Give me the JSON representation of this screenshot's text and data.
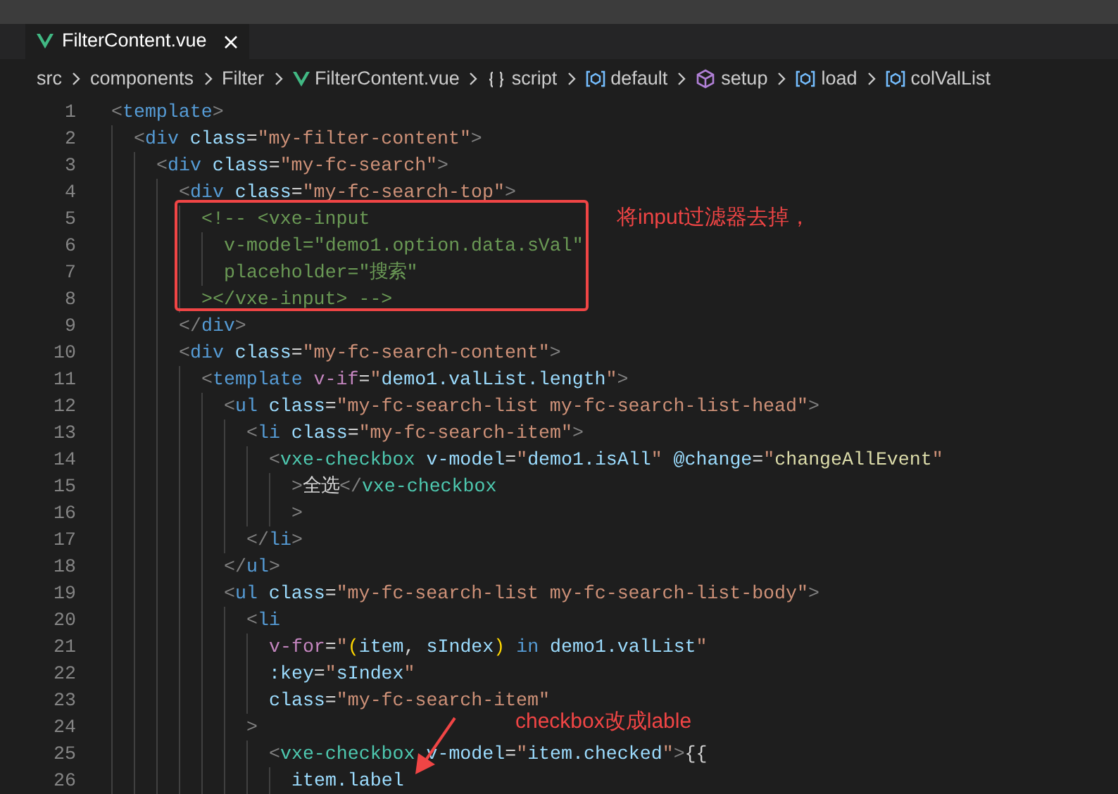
{
  "tabs": [
    {
      "label": "FilterContent.vue",
      "kind": "vue",
      "selected": true
    }
  ],
  "breadcrumb": [
    {
      "label": "src",
      "kind": "folder"
    },
    {
      "label": "components",
      "kind": "folder"
    },
    {
      "label": "Filter",
      "kind": "folder"
    },
    {
      "label": "FilterContent.vue",
      "kind": "vue"
    },
    {
      "label": "script",
      "kind": "block"
    },
    {
      "label": "default",
      "kind": "field"
    },
    {
      "label": "setup",
      "kind": "method"
    },
    {
      "label": "load",
      "kind": "field"
    },
    {
      "label": "colValList",
      "kind": "field"
    }
  ],
  "code": [
    {
      "number": "1",
      "tokens": [
        {
          "kind": "punct",
          "text": "<"
        },
        {
          "kind": "tag",
          "text": "template"
        },
        {
          "kind": "punct",
          "text": ">"
        }
      ]
    },
    {
      "number": "2",
      "tokens": [
        {
          "kind": "punct",
          "text": "  <"
        },
        {
          "kind": "tag",
          "text": "div"
        },
        {
          "kind": "attr",
          "text": " class"
        },
        {
          "kind": "plain",
          "text": "="
        },
        {
          "kind": "string",
          "text": "\"my-filter-content\""
        },
        {
          "kind": "punct",
          "text": ">"
        }
      ]
    },
    {
      "number": "3",
      "tokens": [
        {
          "kind": "punct",
          "text": "    <"
        },
        {
          "kind": "tag",
          "text": "div"
        },
        {
          "kind": "attr",
          "text": " class"
        },
        {
          "kind": "plain",
          "text": "="
        },
        {
          "kind": "string",
          "text": "\"my-fc-search\""
        },
        {
          "kind": "punct",
          "text": ">"
        }
      ]
    },
    {
      "number": "4",
      "tokens": [
        {
          "kind": "punct",
          "text": "      <"
        },
        {
          "kind": "tag",
          "text": "div"
        },
        {
          "kind": "attr",
          "text": " class"
        },
        {
          "kind": "plain",
          "text": "="
        },
        {
          "kind": "string",
          "text": "\"my-fc-search-top\""
        },
        {
          "kind": "punct",
          "text": ">"
        }
      ]
    },
    {
      "number": "5",
      "tokens": [
        {
          "kind": "comment",
          "text": "        <!-- <vxe-input"
        }
      ]
    },
    {
      "number": "6",
      "tokens": [
        {
          "kind": "comment",
          "text": "          v-model=\"demo1.option.data.sVal\""
        }
      ]
    },
    {
      "number": "7",
      "tokens": [
        {
          "kind": "comment",
          "text": "          placeholder=\"搜索\""
        }
      ]
    },
    {
      "number": "8",
      "tokens": [
        {
          "kind": "comment",
          "text": "        ></vxe-input> -->"
        }
      ]
    },
    {
      "number": "9",
      "tokens": [
        {
          "kind": "punct",
          "text": "      </"
        },
        {
          "kind": "tag",
          "text": "div"
        },
        {
          "kind": "punct",
          "text": ">"
        }
      ]
    },
    {
      "number": "10",
      "tokens": [
        {
          "kind": "punct",
          "text": "      <"
        },
        {
          "kind": "tag",
          "text": "div"
        },
        {
          "kind": "attr",
          "text": " class"
        },
        {
          "kind": "plain",
          "text": "="
        },
        {
          "kind": "string",
          "text": "\"my-fc-search-content\""
        },
        {
          "kind": "punct",
          "text": ">"
        }
      ]
    },
    {
      "number": "11",
      "tokens": [
        {
          "kind": "punct",
          "text": "        <"
        },
        {
          "kind": "tag",
          "text": "template"
        },
        {
          "kind": "directive",
          "text": " v-if"
        },
        {
          "kind": "plain",
          "text": "="
        },
        {
          "kind": "string",
          "text": "\""
        },
        {
          "kind": "variable",
          "text": "demo1.valList.length"
        },
        {
          "kind": "string",
          "text": "\""
        },
        {
          "kind": "punct",
          "text": ">"
        }
      ]
    },
    {
      "number": "12",
      "tokens": [
        {
          "kind": "punct",
          "text": "          <"
        },
        {
          "kind": "tag",
          "text": "ul"
        },
        {
          "kind": "attr",
          "text": " class"
        },
        {
          "kind": "plain",
          "text": "="
        },
        {
          "kind": "string",
          "text": "\"my-fc-search-list my-fc-search-list-head\""
        },
        {
          "kind": "punct",
          "text": ">"
        }
      ]
    },
    {
      "number": "13",
      "tokens": [
        {
          "kind": "punct",
          "text": "            <"
        },
        {
          "kind": "tag",
          "text": "li"
        },
        {
          "kind": "attr",
          "text": " class"
        },
        {
          "kind": "plain",
          "text": "="
        },
        {
          "kind": "string",
          "text": "\"my-fc-search-item\""
        },
        {
          "kind": "punct",
          "text": ">"
        }
      ]
    },
    {
      "number": "14",
      "tokens": [
        {
          "kind": "punct",
          "text": "              <"
        },
        {
          "kind": "component",
          "text": "vxe-checkbox"
        },
        {
          "kind": "attr",
          "text": " v-model"
        },
        {
          "kind": "plain",
          "text": "="
        },
        {
          "kind": "string",
          "text": "\""
        },
        {
          "kind": "variable",
          "text": "demo1.isAll"
        },
        {
          "kind": "string",
          "text": "\""
        },
        {
          "kind": "attr",
          "text": " @change"
        },
        {
          "kind": "plain",
          "text": "="
        },
        {
          "kind": "string",
          "text": "\""
        },
        {
          "kind": "function",
          "text": "changeAllEvent"
        },
        {
          "kind": "string",
          "text": "\""
        }
      ]
    },
    {
      "number": "15",
      "tokens": [
        {
          "kind": "punct",
          "text": "                >"
        },
        {
          "kind": "plain",
          "text": "全选"
        },
        {
          "kind": "punct",
          "text": "</"
        },
        {
          "kind": "component",
          "text": "vxe-checkbox"
        }
      ]
    },
    {
      "number": "16",
      "tokens": [
        {
          "kind": "punct",
          "text": "                >"
        }
      ]
    },
    {
      "number": "17",
      "tokens": [
        {
          "kind": "punct",
          "text": "            </"
        },
        {
          "kind": "tag",
          "text": "li"
        },
        {
          "kind": "punct",
          "text": ">"
        }
      ]
    },
    {
      "number": "18",
      "tokens": [
        {
          "kind": "punct",
          "text": "          </"
        },
        {
          "kind": "tag",
          "text": "ul"
        },
        {
          "kind": "punct",
          "text": ">"
        }
      ]
    },
    {
      "number": "19",
      "tokens": [
        {
          "kind": "punct",
          "text": "          <"
        },
        {
          "kind": "tag",
          "text": "ul"
        },
        {
          "kind": "attr",
          "text": " class"
        },
        {
          "kind": "plain",
          "text": "="
        },
        {
          "kind": "string",
          "text": "\"my-fc-search-list my-fc-search-list-body\""
        },
        {
          "kind": "punct",
          "text": ">"
        }
      ]
    },
    {
      "number": "20",
      "tokens": [
        {
          "kind": "punct",
          "text": "            <"
        },
        {
          "kind": "tag",
          "text": "li"
        }
      ]
    },
    {
      "number": "21",
      "tokens": [
        {
          "kind": "directive",
          "text": "              v-for"
        },
        {
          "kind": "plain",
          "text": "="
        },
        {
          "kind": "string",
          "text": "\""
        },
        {
          "kind": "bracket",
          "text": "("
        },
        {
          "kind": "variable",
          "text": "item"
        },
        {
          "kind": "plain",
          "text": ", "
        },
        {
          "kind": "variable",
          "text": "sIndex"
        },
        {
          "kind": "bracket",
          "text": ")"
        },
        {
          "kind": "keyword",
          "text": " in "
        },
        {
          "kind": "variable",
          "text": "demo1.valList"
        },
        {
          "kind": "string",
          "text": "\""
        }
      ]
    },
    {
      "number": "22",
      "tokens": [
        {
          "kind": "attr",
          "text": "              :key"
        },
        {
          "kind": "plain",
          "text": "="
        },
        {
          "kind": "string",
          "text": "\""
        },
        {
          "kind": "variable",
          "text": "sIndex"
        },
        {
          "kind": "string",
          "text": "\""
        }
      ]
    },
    {
      "number": "23",
      "tokens": [
        {
          "kind": "attr",
          "text": "              class"
        },
        {
          "kind": "plain",
          "text": "="
        },
        {
          "kind": "string",
          "text": "\"my-fc-search-item\""
        }
      ]
    },
    {
      "number": "24",
      "tokens": [
        {
          "kind": "punct",
          "text": "            >"
        }
      ]
    },
    {
      "number": "25",
      "tokens": [
        {
          "kind": "punct",
          "text": "              <"
        },
        {
          "kind": "component",
          "text": "vxe-checkbox"
        },
        {
          "kind": "attr",
          "text": " v-model"
        },
        {
          "kind": "plain",
          "text": "="
        },
        {
          "kind": "string",
          "text": "\""
        },
        {
          "kind": "variable",
          "text": "item.checked"
        },
        {
          "kind": "string",
          "text": "\""
        },
        {
          "kind": "punct",
          "text": ">"
        },
        {
          "kind": "plain",
          "text": "{{"
        }
      ]
    },
    {
      "number": "26",
      "tokens": [
        {
          "kind": "variable",
          "text": "                item.label"
        }
      ]
    }
  ],
  "annotations": [
    {
      "kind": "box-note",
      "text": "将input过滤器去掉，"
    },
    {
      "kind": "arrow-note",
      "text": "checkbox改成lable"
    }
  ]
}
